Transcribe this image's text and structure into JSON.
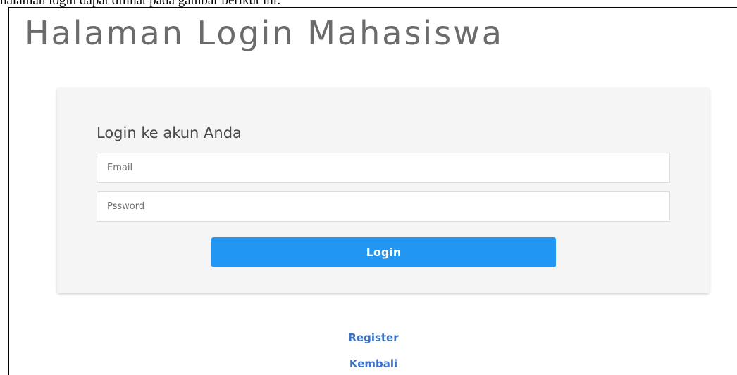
{
  "document": {
    "caption": "halaman login dapat dilihat pada gambar berikut ini:"
  },
  "page": {
    "title": "Halaman Login Mahasiswa"
  },
  "login_form": {
    "heading": "Login ke akun Anda",
    "email_placeholder": "Email",
    "email_value": "",
    "password_placeholder": "Pssword",
    "password_value": "",
    "submit_label": "Login"
  },
  "links": {
    "register": "Register",
    "back": "Kembali"
  },
  "colors": {
    "title_text": "#6b6b6b",
    "card_background": "#f5f5f5",
    "button_background": "#2196f3",
    "link_text": "#3b73c8"
  }
}
